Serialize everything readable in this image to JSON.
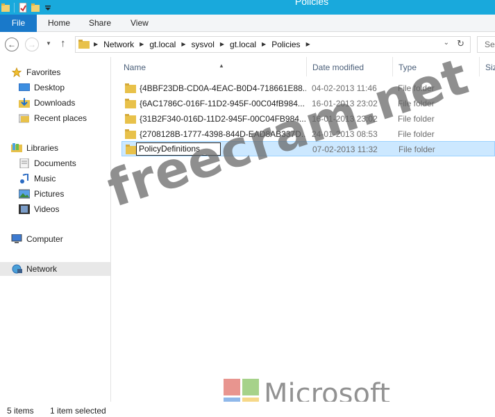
{
  "window": {
    "title": "Policies"
  },
  "ribbon": {
    "tabs": [
      "File",
      "Home",
      "Share",
      "View"
    ]
  },
  "address": {
    "crumbs": [
      "Network",
      "gt.local",
      "sysvol",
      "gt.local",
      "Policies"
    ],
    "search_placeholder": "Sea"
  },
  "navpane": {
    "favorites": "Favorites",
    "desktop": "Desktop",
    "downloads": "Downloads",
    "recent": "Recent places",
    "libraries": "Libraries",
    "documents": "Documents",
    "music": "Music",
    "pictures": "Pictures",
    "videos": "Videos",
    "computer": "Computer",
    "network": "Network"
  },
  "columns": {
    "name": "Name",
    "date": "Date modified",
    "type": "Type",
    "size": "Size"
  },
  "files": [
    {
      "name": "{4BBF23DB-CD0A-4EAC-B0D4-718661E88...",
      "date": "04-02-2013 11:46",
      "type": "File folder"
    },
    {
      "name": "{6AC1786C-016F-11D2-945F-00C04fB984...",
      "date": "16-01-2013 23:02",
      "type": "File folder"
    },
    {
      "name": "{31B2F340-016D-11D2-945F-00C04FB984...",
      "date": "16-01-2013 23:02",
      "type": "File folder"
    },
    {
      "name": "{2708128B-1777-4398-844D-EAD8AB337D...",
      "date": "24-01-2013 08:53",
      "type": "File folder"
    },
    {
      "name": "PolicyDefinitions",
      "date": "07-02-2013 11:32",
      "type": "File folder"
    }
  ],
  "status": {
    "count": "5 items",
    "selected": "1 item selected"
  },
  "watermark": {
    "site": "freecram.net",
    "brand": "Microsoft"
  },
  "colors": {
    "titlebar": "#19a9dc",
    "file_tab": "#1979ca",
    "selection": "#cce8ff",
    "folder": "#e8c14a"
  }
}
